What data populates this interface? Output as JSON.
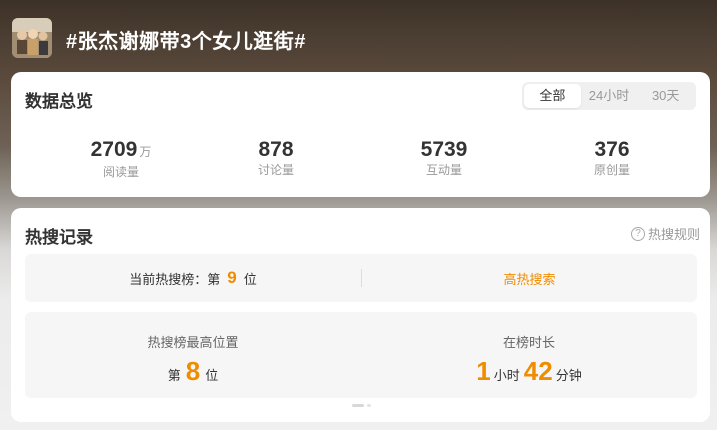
{
  "header": {
    "topic_title": "#张杰谢娜带3个女儿逛街#",
    "thumbnail_icon": "topic-thumbnail-image"
  },
  "overview": {
    "title": "数据总览",
    "tabs": [
      {
        "label": "全部",
        "active": true
      },
      {
        "label": "24小时",
        "active": false
      },
      {
        "label": "30天",
        "active": false
      }
    ],
    "stats": [
      {
        "value": "2709",
        "unit": "万",
        "label": "阅读量"
      },
      {
        "value": "878",
        "unit": "",
        "label": "讨论量"
      },
      {
        "value": "5739",
        "unit": "",
        "label": "互动量"
      },
      {
        "value": "376",
        "unit": "",
        "label": "原创量"
      }
    ]
  },
  "hot_record": {
    "title": "热搜记录",
    "rules_label": "热搜规则",
    "rules_icon": "question-circle-icon",
    "current": {
      "prefix": "当前热搜榜：第",
      "rank": "9",
      "suffix": "位",
      "link_label": "高热搜索"
    },
    "best_position": {
      "label": "热搜榜最高位置",
      "prefix": "第",
      "rank": "8",
      "suffix": "位"
    },
    "duration": {
      "label": "在榜时长",
      "hours": "1",
      "hours_unit": "小时",
      "minutes": "42",
      "minutes_unit": "分钟"
    }
  },
  "colors": {
    "accent": "#f08c00",
    "card_bg": "#ffffff",
    "row_bg": "#f6f6f6"
  }
}
